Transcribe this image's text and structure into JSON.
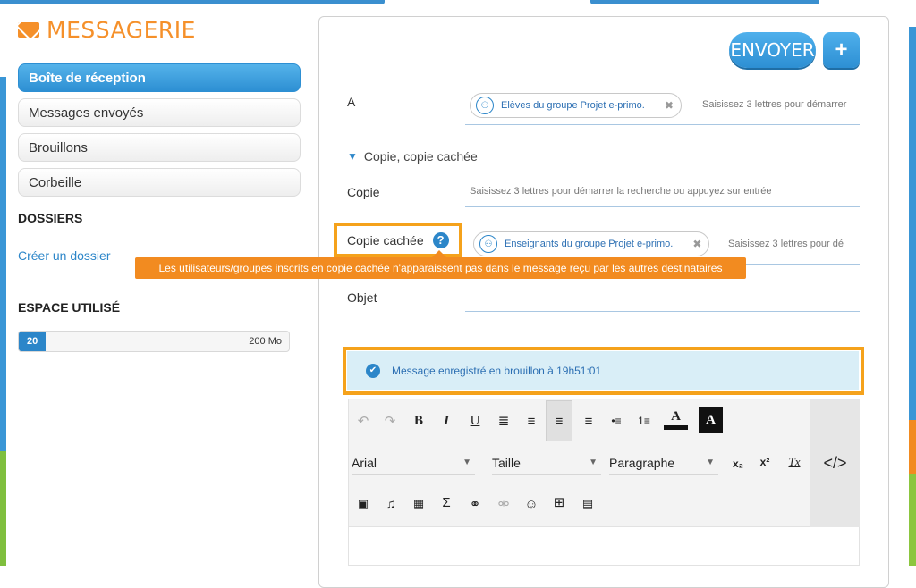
{
  "app": {
    "title": "MESSAGERIE",
    "icon": "envelope-icon"
  },
  "sidebar": {
    "items": [
      {
        "label": "Boîte de réception",
        "active": true
      },
      {
        "label": "Messages envoyés",
        "active": false
      },
      {
        "label": "Brouillons",
        "active": false
      },
      {
        "label": "Corbeille",
        "active": false
      }
    ],
    "folders_heading": "DOSSIERS",
    "create_folder": "Créer un dossier",
    "storage_heading": "ESPACE UTILISÉ",
    "storage_used": "20",
    "storage_total": "200 Mo",
    "storage_fraction": 0.1
  },
  "compose": {
    "send_label": "ENVOYER",
    "plus_label": "+",
    "to_label": "A",
    "to_chip": "Elèves du groupe Projet e-primo.",
    "to_placeholder": "Saisissez 3 lettres pour démarrer",
    "cc_toggle": "Copie, copie cachée",
    "cc_label": "Copie",
    "cc_placeholder": "Saisissez 3 lettres pour démarrer la recherche ou appuyez sur entrée",
    "bcc_label": "Copie cachée",
    "bcc_chip": "Enseignants du groupe Projet e-primo.",
    "bcc_placeholder": "Saisissez 3 lettres pour dé",
    "bcc_tooltip": "Les utilisateurs/groupes inscrits en copie cachée n'apparaissent pas dans le message reçu par les autres destinataires",
    "subject_label": "Objet",
    "draft_notice": "Message enregistré en brouillon à 19h51:01"
  },
  "editor": {
    "font": "Arial",
    "size": "Taille",
    "format": "Paragraphe",
    "source_label": "</>",
    "buttons": {
      "undo": "↶",
      "redo": "↷",
      "bold": "B",
      "italic": "I",
      "underline": "U",
      "justify": "≣",
      "center": "≡",
      "left": "≡",
      "right": "≡",
      "bullets": "•≡",
      "numbers": "1≡",
      "text_color": "A",
      "bg_color": "A",
      "sub": "x₂",
      "sup": "x²",
      "clear": "Tx",
      "image": "▣",
      "music": "♫",
      "video": "▦",
      "sigma": "Σ",
      "link": "⚭",
      "unlink": "⚮",
      "smiley": "☺",
      "table": "⊞",
      "doc": "▤"
    }
  },
  "colors": {
    "accent": "#2c86c9",
    "brand": "#f5902a",
    "highlight": "#f5a21b",
    "tooltip": "#f28b20"
  }
}
